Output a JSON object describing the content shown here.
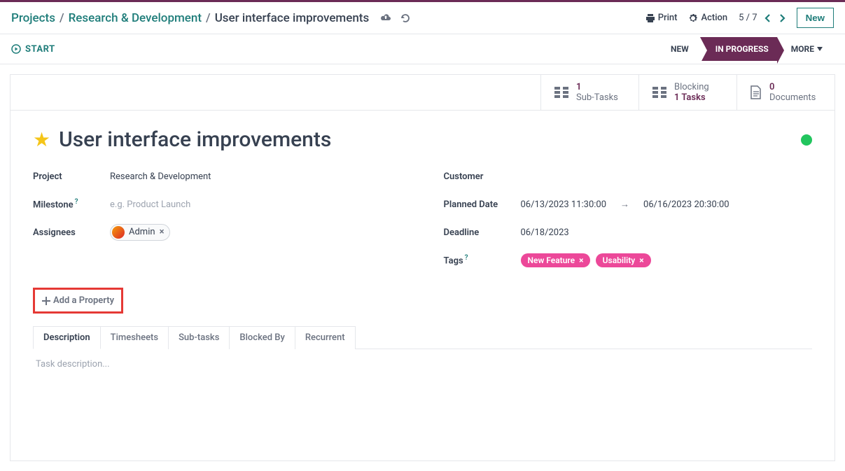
{
  "breadcrumbs": {
    "root": "Projects",
    "parent": "Research & Development",
    "current": "User interface improvements"
  },
  "top": {
    "print": "Print",
    "action": "Action",
    "pager": "5 / 7",
    "new": "New"
  },
  "statusbar": {
    "start": "START",
    "stage_new": "NEW",
    "stage_progress": "IN PROGRESS",
    "more": "MORE"
  },
  "statboxes": {
    "subtasks_count": "1",
    "subtasks_label": "Sub-Tasks",
    "blocking_label": "Blocking",
    "blocking_count": "1 Tasks",
    "documents_count": "0",
    "documents_label": "Documents"
  },
  "task": {
    "title": "User interface improvements",
    "project_label": "Project",
    "project_value": "Research & Development",
    "milestone_label": "Milestone",
    "milestone_placeholder": "e.g. Product Launch",
    "assignees_label": "Assignees",
    "assignee_name": "Admin",
    "customer_label": "Customer",
    "planned_label": "Planned Date",
    "planned_start": "06/13/2023 11:30:00",
    "planned_end": "06/16/2023 20:30:00",
    "deadline_label": "Deadline",
    "deadline_value": "06/18/2023",
    "tags_label": "Tags",
    "tag1": "New Feature",
    "tag2": "Usability",
    "add_property": "Add a Property"
  },
  "tabs": {
    "description": "Description",
    "timesheets": "Timesheets",
    "subtasks": "Sub-tasks",
    "blockedby": "Blocked By",
    "recurrent": "Recurrent",
    "description_placeholder": "Task description..."
  }
}
